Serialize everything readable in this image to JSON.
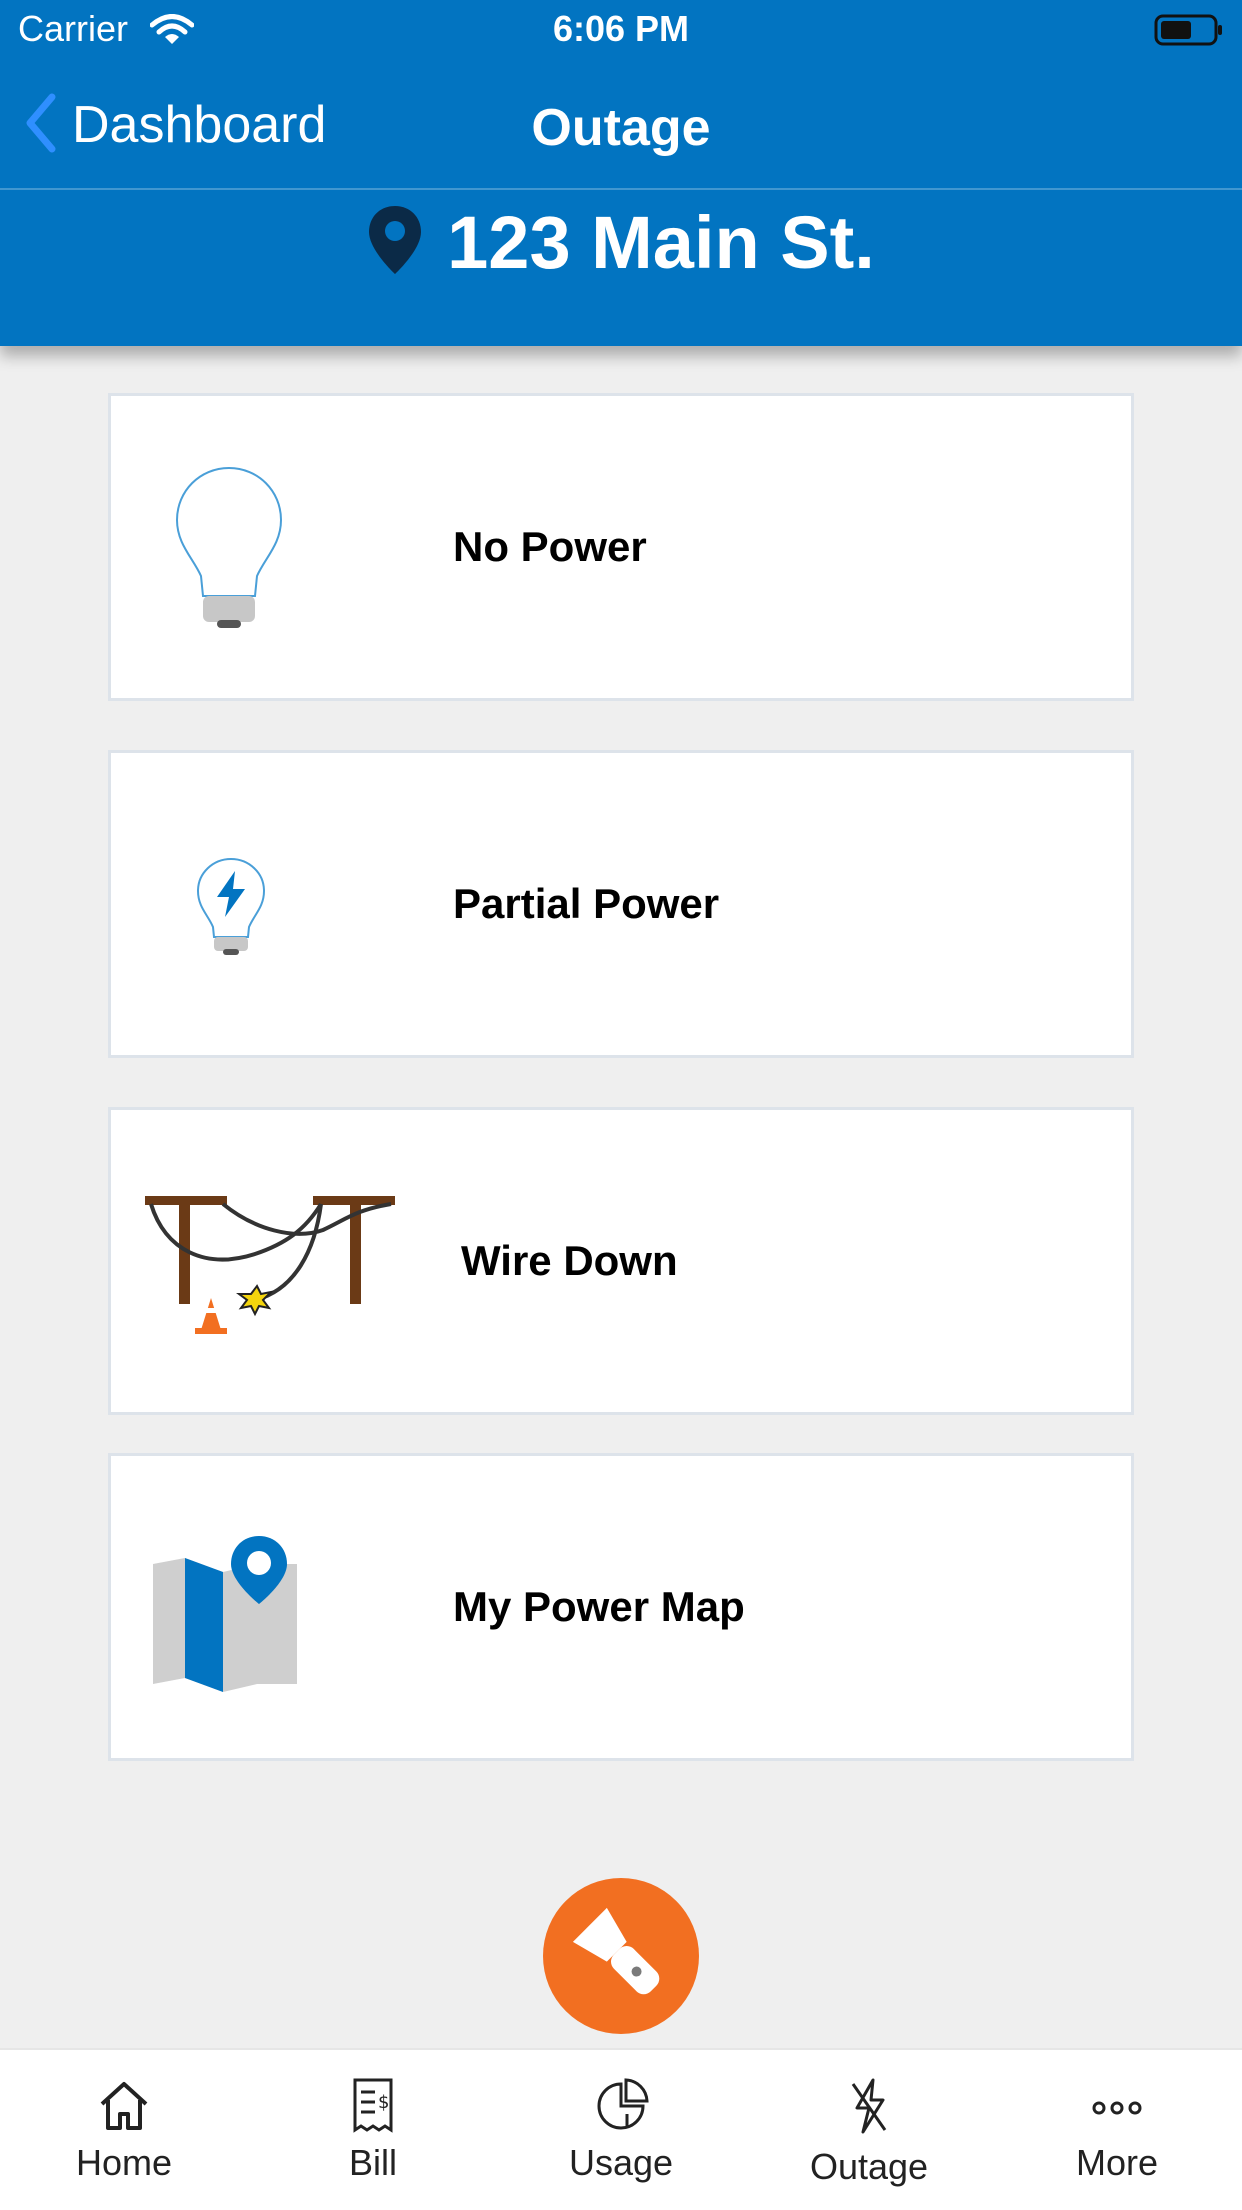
{
  "status_bar": {
    "carrier": "Carrier",
    "time": "6:06 PM"
  },
  "nav": {
    "back_label": "Dashboard",
    "title": "Outage"
  },
  "address": "123 Main St.",
  "options": [
    {
      "label": "No Power",
      "icon": "lightbulb-icon"
    },
    {
      "label": "Partial Power",
      "icon": "lightbulb-bolt-icon"
    },
    {
      "label": "Wire Down",
      "icon": "downed-wire-icon"
    },
    {
      "label": "My Power Map",
      "icon": "map-pin-icon"
    }
  ],
  "fab": {
    "icon": "flashlight-icon"
  },
  "tabs": [
    {
      "label": "Home",
      "icon": "home-icon"
    },
    {
      "label": "Bill",
      "icon": "bill-icon"
    },
    {
      "label": "Usage",
      "icon": "usage-icon"
    },
    {
      "label": "Outage",
      "icon": "outage-icon",
      "active": true
    },
    {
      "label": "More",
      "icon": "more-icon"
    }
  ],
  "colors": {
    "brand_blue": "#0274c1",
    "accent_orange": "#f26f21",
    "background": "#efefef"
  }
}
